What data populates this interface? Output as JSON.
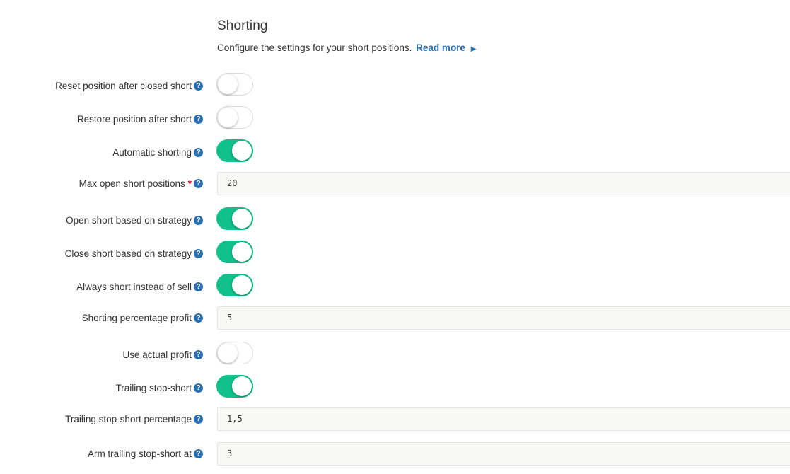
{
  "header": {
    "title": "Shorting",
    "description": "Configure the settings for your short positions.",
    "read_more": "Read more"
  },
  "icons": {
    "help": "question-circle-icon",
    "caret": "caret-right-icon"
  },
  "colors": {
    "toggle_on": "#12c08c",
    "link": "#2a6fb0",
    "required": "#d0021b"
  },
  "fields": [
    {
      "label": "Reset position after closed short",
      "type": "toggle",
      "on": false
    },
    {
      "label": "Restore position after short",
      "type": "toggle",
      "on": false
    },
    {
      "label": "Automatic shorting",
      "type": "toggle",
      "on": true
    },
    {
      "label": "Max open short positions",
      "type": "input",
      "value": "20",
      "required": true
    },
    {
      "label": "Open short based on strategy",
      "type": "toggle",
      "on": true
    },
    {
      "label": "Close short based on strategy",
      "type": "toggle",
      "on": true
    },
    {
      "label": "Always short instead of sell",
      "type": "toggle",
      "on": true
    },
    {
      "label": "Shorting percentage profit",
      "type": "input",
      "value": "5"
    },
    {
      "label": "Use actual profit",
      "type": "toggle",
      "on": false
    },
    {
      "label": "Trailing stop-short",
      "type": "toggle",
      "on": true
    },
    {
      "label": "Trailing stop-short percentage",
      "type": "input",
      "value": "1,5"
    },
    {
      "label": "Arm trailing stop-short at",
      "type": "input",
      "value": "3"
    }
  ]
}
